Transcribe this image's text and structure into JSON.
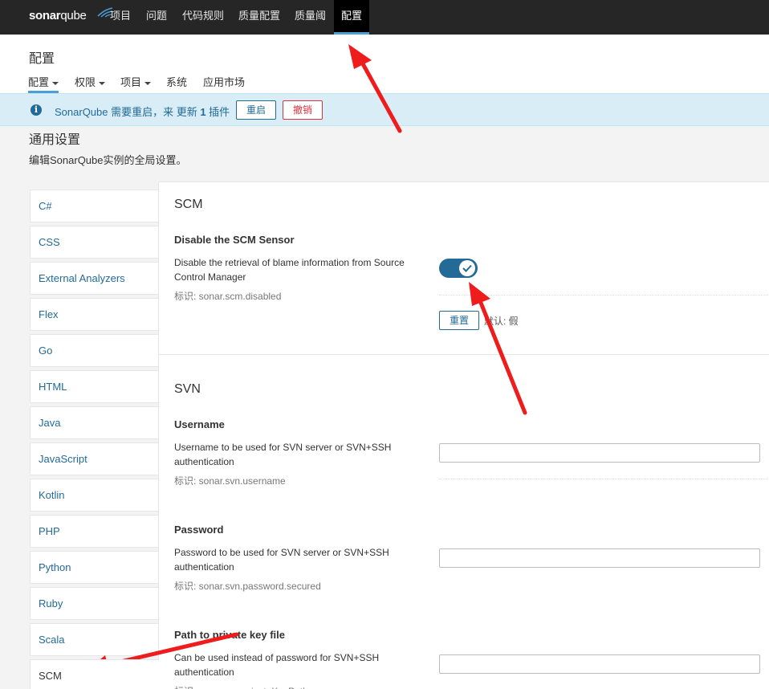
{
  "topnav": {
    "logo_main": "sonar",
    "logo_q": "qube",
    "items": [
      {
        "label": "项目"
      },
      {
        "label": "问题"
      },
      {
        "label": "代码规则"
      },
      {
        "label": "质量配置"
      },
      {
        "label": "质量阈"
      },
      {
        "label": "配置"
      }
    ],
    "active_index": 5
  },
  "page": {
    "title": "配置",
    "subnav": [
      {
        "label": "配置"
      },
      {
        "label": "权限"
      },
      {
        "label": "项目"
      },
      {
        "label": "系统"
      },
      {
        "label": "应用市场"
      }
    ]
  },
  "notice": {
    "text_before": "SonarQube 需要重启，来 更新 ",
    "count": "1",
    "text_after": " 插件",
    "restart_label": "重启",
    "cancel_label": "撤销"
  },
  "general": {
    "title": "通用设置",
    "description": "编辑SonarQube实例的全局设置。"
  },
  "sidebar": {
    "items": [
      {
        "label": "C#"
      },
      {
        "label": "CSS"
      },
      {
        "label": "External Analyzers"
      },
      {
        "label": "Flex"
      },
      {
        "label": "Go"
      },
      {
        "label": "HTML"
      },
      {
        "label": "Java"
      },
      {
        "label": "JavaScript"
      },
      {
        "label": "Kotlin"
      },
      {
        "label": "PHP"
      },
      {
        "label": "Python"
      },
      {
        "label": "Ruby"
      },
      {
        "label": "Scala"
      },
      {
        "label": "SCM"
      }
    ],
    "active": "SCM"
  },
  "scm": {
    "title": "SCM",
    "setting": {
      "name": "Disable the SCM Sensor",
      "description": "Disable the retrieval of blame information from Source Control Manager",
      "key": "标识: sonar.scm.disabled",
      "toggle_on": true,
      "reset_label": "重置",
      "default_text": "默认: 假"
    }
  },
  "svn": {
    "title": "SVN",
    "username": {
      "name": "Username",
      "description": "Username to be used for SVN server or SVN+SSH authentication",
      "key": "标识: sonar.svn.username",
      "value": ""
    },
    "password": {
      "name": "Password",
      "description": "Password to be used for SVN server or SVN+SSH authentication",
      "key": "标识: sonar.svn.password.secured",
      "value": ""
    },
    "private_key": {
      "name": "Path to private key file",
      "description": "Can be used instead of password for SVN+SSH authentication",
      "key": "标识: sonar.svn.privateKeyPath",
      "value": ""
    }
  },
  "colors": {
    "accent": "#236a97",
    "danger": "#d4333f",
    "topnav_bg": "#262626",
    "annotation_arrow": "#ee1c1c"
  }
}
